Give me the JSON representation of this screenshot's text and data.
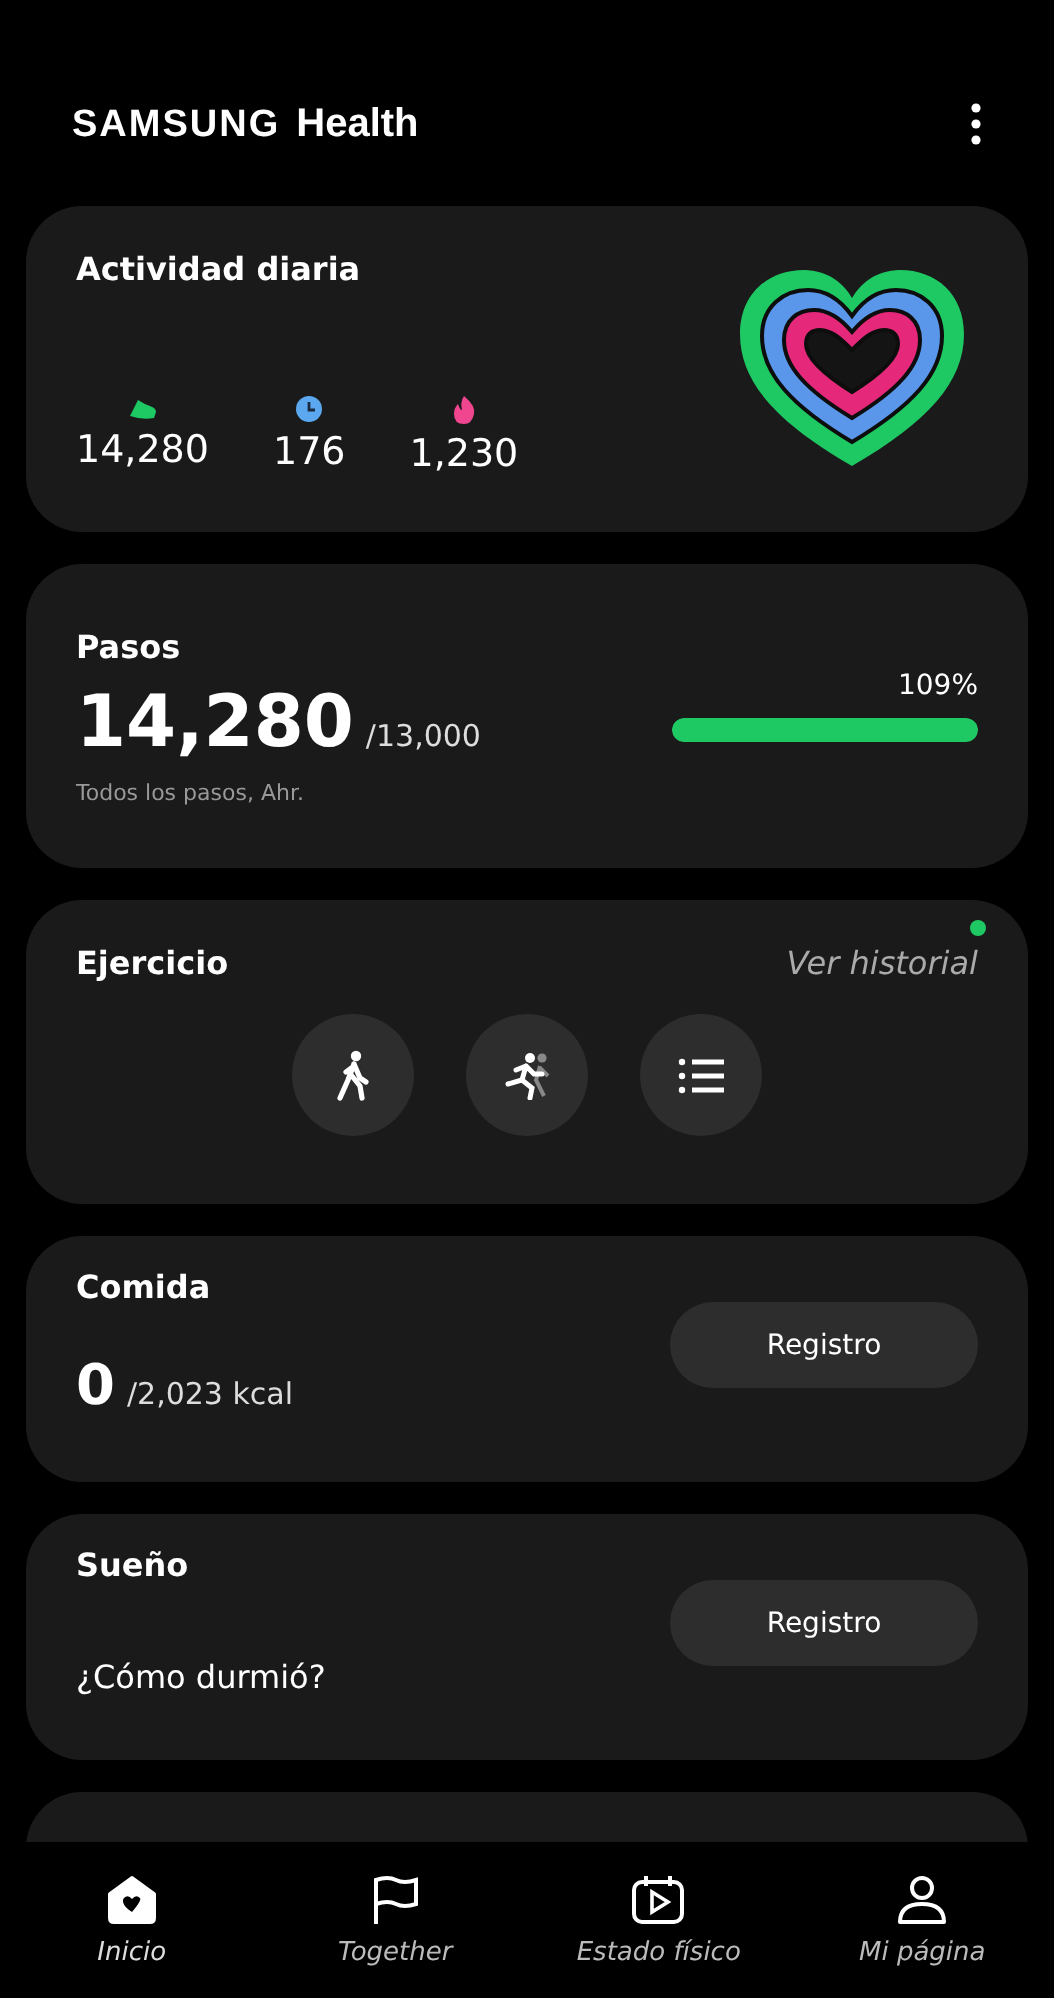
{
  "header": {
    "brand": "SAMSUNG",
    "product": "Health"
  },
  "activity": {
    "title": "Actividad diaria",
    "stats": [
      {
        "kind": "steps",
        "value": "14,280",
        "color": "#1ec863"
      },
      {
        "kind": "time",
        "value": "176",
        "color": "#5ba8f0"
      },
      {
        "kind": "calories",
        "value": "1,230",
        "color": "#f0458f"
      }
    ]
  },
  "steps": {
    "title": "Pasos",
    "value": "14,280",
    "goal": "/13,000",
    "note": "Todos los pasos, Ahr.",
    "percent": "109%",
    "level": 1.0
  },
  "exercise": {
    "title": "Ejercicio",
    "link": "Ver historial",
    "link_dot": true,
    "buttons": [
      {
        "kind": "walk"
      },
      {
        "kind": "run"
      },
      {
        "kind": "list"
      }
    ]
  },
  "food": {
    "title": "Comida",
    "value": "0",
    "goal": "/2,023 kcal",
    "button": "Registro"
  },
  "sleep": {
    "title": "Sueño",
    "question": "¿Cómo durmió?",
    "button": "Registro"
  },
  "nav": [
    {
      "kind": "home",
      "label": "Inicio",
      "selected": true
    },
    {
      "kind": "flag",
      "label": "Together",
      "selected": false
    },
    {
      "kind": "fitness",
      "label": "Estado físico",
      "selected": false
    },
    {
      "kind": "profile",
      "label": "Mi página",
      "selected": false
    }
  ]
}
